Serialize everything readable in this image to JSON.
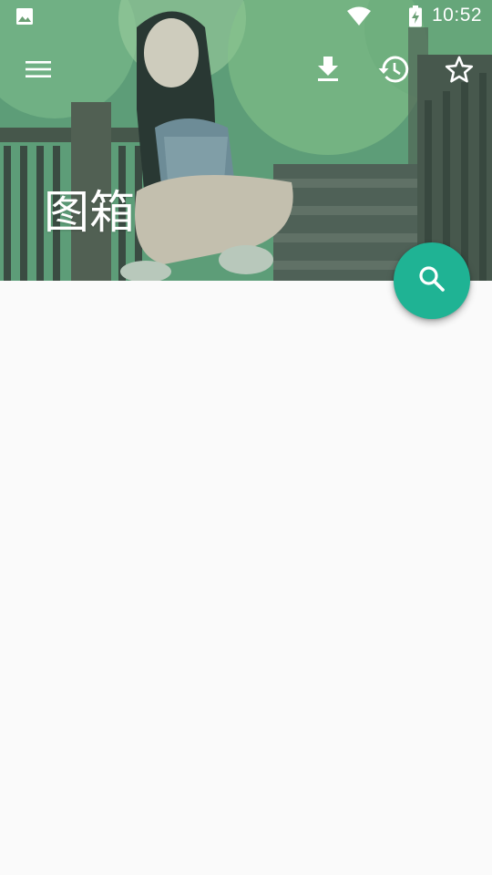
{
  "status_bar": {
    "time": "10:52",
    "icons": [
      "gallery-icon",
      "wifi-icon",
      "battery-charging-icon"
    ]
  },
  "toolbar": {
    "icons": [
      "menu-icon",
      "download-icon",
      "history-icon",
      "star-icon"
    ]
  },
  "header": {
    "title": "图箱"
  },
  "fab": {
    "icon": "search-icon"
  },
  "colors": {
    "accent": "#1fb394",
    "background": "#fafafa",
    "on_header": "#ffffff"
  }
}
